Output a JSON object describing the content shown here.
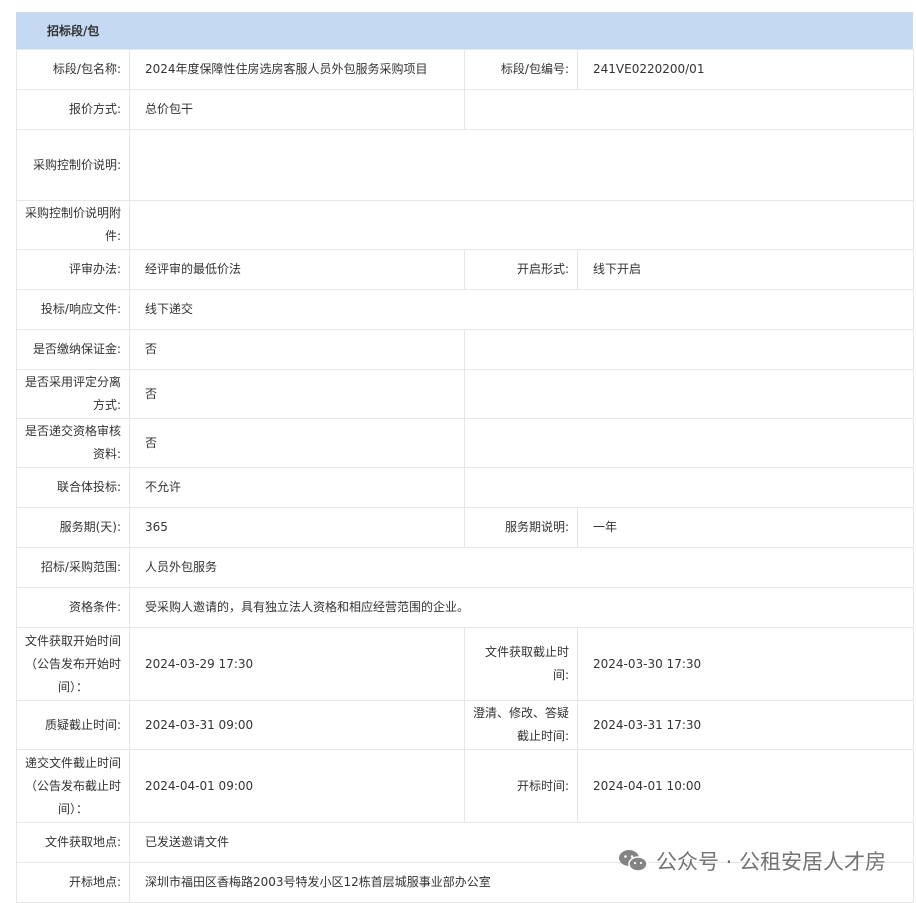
{
  "section": {
    "title": "招标段/包"
  },
  "rows": {
    "name_label": "标段/包名称:",
    "name_value": "2024年度保障性住房选房客服人员外包服务采购项目",
    "code_label": "标段/包编号:",
    "code_value": "241VE0220200/01",
    "quote_label": "报价方式:",
    "quote_value": "总价包干",
    "ctrl_label": "采购控制价说明:",
    "ctrl_att_label": "采购控制价说明附件:",
    "eval_label": "评审办法:",
    "eval_value": "经评审的最低价法",
    "open_form_label": "开启形式:",
    "open_form_value": "线下开启",
    "bid_doc_label": "投标/响应文件:",
    "bid_doc_value": "线下递交",
    "deposit_label": "是否缴纳保证金:",
    "deposit_value": "否",
    "separate_label": "是否采用评定分离方式:",
    "separate_value": "否",
    "qual_submit_label": "是否递交资格审核资料:",
    "qual_submit_value": "否",
    "consortium_label": "联合体投标:",
    "consortium_value": "不允许",
    "period_label": "服务期(天):",
    "period_value": "365",
    "period_desc_label": "服务期说明:",
    "period_desc_value": "一年",
    "scope_label": "招标/采购范围:",
    "scope_value": "人员外包服务",
    "qualification_label": "资格条件:",
    "qualification_value": "受采购人邀请的，具有独立法人资格和相应经营范围的企业。",
    "doc_start_label": "文件获取开始时间（公告发布开始时间）：",
    "doc_start_value": "2024-03-29 17:30",
    "doc_end_label": "文件获取截止时间:",
    "doc_end_value": "2024-03-30 17:30",
    "query_end_label": "质疑截止时间:",
    "query_end_value": "2024-03-31 09:00",
    "clarify_end_label": "澄清、修改、答疑截止时间:",
    "clarify_end_value": "2024-03-31 17:30",
    "submit_end_label": "递交文件截止时间（公告发布截止时间）：",
    "submit_end_value": "2024-04-01 09:00",
    "open_time_label": "开标时间:",
    "open_time_value": "2024-04-01 10:00",
    "doc_place_label": "文件获取地点:",
    "doc_place_value": "已发送邀请文件",
    "open_place_label": "开标地点:",
    "open_place_value": "深圳市福田区香梅路2003号特发小区12栋首层城服事业部办公室"
  },
  "watermark": {
    "text": "公众号 · 公租安居人才房",
    "icon": "wechat-icon"
  }
}
